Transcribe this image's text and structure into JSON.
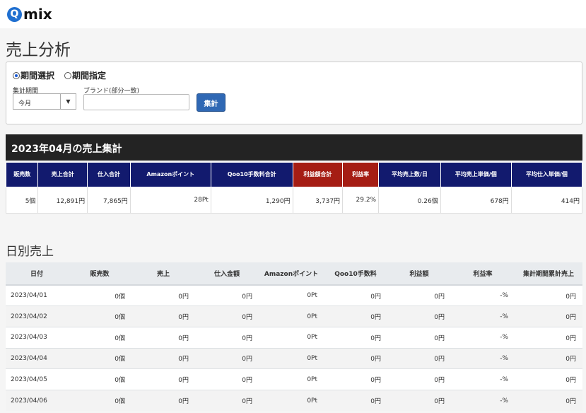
{
  "app": {
    "logo_letter": "Q",
    "logo_rest": "mix"
  },
  "page": {
    "title": "売上分析"
  },
  "filter": {
    "radio_period_select": "期間選択",
    "radio_period_specify": "期間指定",
    "aggregation_label": "集計期間",
    "aggregation_value": "今月",
    "brand_label": "ブランド(部分一致)",
    "brand_value": "",
    "submit_label": "集計"
  },
  "summary": {
    "title": "2023年04月の売上集計",
    "headers": [
      "販売数",
      "売上合計",
      "仕入合計",
      "Amazonポイント",
      "Qoo10手数料合計",
      "利益額合計",
      "利益率",
      "平均売上数/日",
      "平均売上単価/個",
      "平均仕入単価/個"
    ],
    "values": [
      "5個",
      "12,891円",
      "7,865円",
      "28Pt",
      "1,290円",
      "3,737円",
      "29.2%",
      "0.26個",
      "678円",
      "414円"
    ]
  },
  "daily": {
    "title": "日別売上",
    "headers": [
      "日付",
      "販売数",
      "売上",
      "仕入金額",
      "Amazonポイント",
      "Qoo10手数料",
      "利益額",
      "利益率",
      "集計期間累計売上"
    ],
    "rows": [
      [
        "2023/04/01",
        "0個",
        "0円",
        "0円",
        "0Pt",
        "0円",
        "0円",
        "-%",
        "0円"
      ],
      [
        "2023/04/02",
        "0個",
        "0円",
        "0円",
        "0Pt",
        "0円",
        "0円",
        "-%",
        "0円"
      ],
      [
        "2023/04/03",
        "0個",
        "0円",
        "0円",
        "0Pt",
        "0円",
        "0円",
        "-%",
        "0円"
      ],
      [
        "2023/04/04",
        "0個",
        "0円",
        "0円",
        "0Pt",
        "0円",
        "0円",
        "-%",
        "0円"
      ],
      [
        "2023/04/05",
        "0個",
        "0円",
        "0円",
        "0Pt",
        "0円",
        "0円",
        "-%",
        "0円"
      ],
      [
        "2023/04/06",
        "0個",
        "0円",
        "0円",
        "0Pt",
        "0円",
        "0円",
        "-%",
        "0円"
      ]
    ]
  },
  "colors": {
    "header_navy": "#121a6e",
    "header_red": "#a51d14",
    "button_blue": "#2f68b4",
    "logo_blue": "#1f6fd0"
  }
}
